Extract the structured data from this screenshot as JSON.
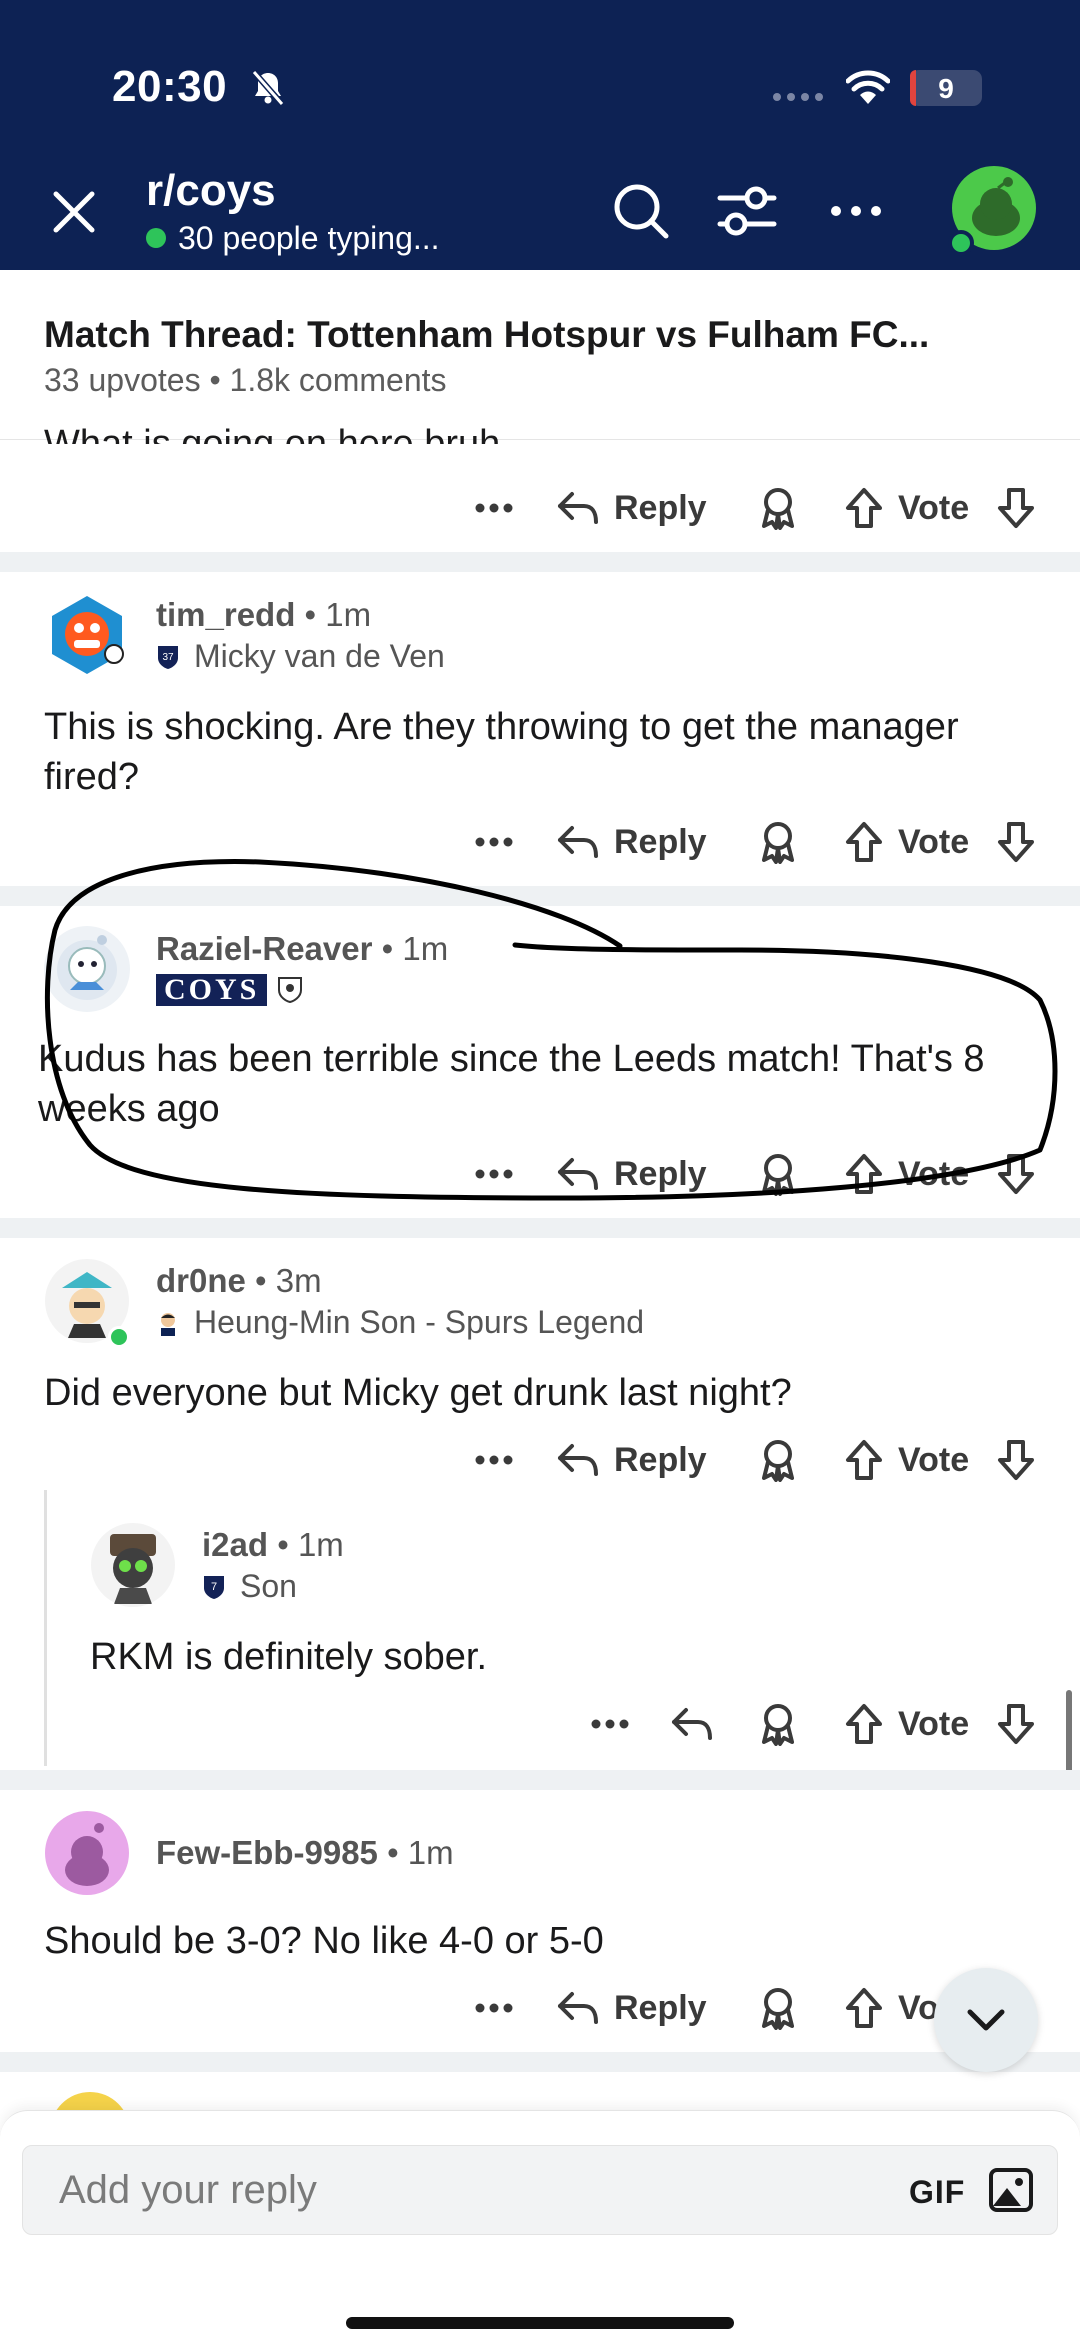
{
  "status_bar": {
    "time": "20:30",
    "battery": "9",
    "battery_level": 0.09
  },
  "header": {
    "subreddit": "r/coys",
    "typing": "30 people typing..."
  },
  "post": {
    "title": "Match Thread: Tottenham Hotspur vs Fulham FC...",
    "upvotes": "33 upvotes",
    "comments": "1.8k comments"
  },
  "partial_comment": {
    "text": "What is going on here bruh"
  },
  "actions": {
    "reply": "Reply",
    "vote": "Vote"
  },
  "comments": [
    {
      "username": "tim_redd",
      "time": "1m",
      "flair": "Micky van de Ven",
      "flair_number": "37",
      "body": "This is shocking. Are they throwing to get the manager fired?"
    },
    {
      "username": "Raziel-Reaver",
      "time": "1m",
      "flair_badge": "COYS",
      "body": "Kudus has been terrible since the Leeds match! That's 8 weeks ago"
    },
    {
      "username": "dr0ne",
      "time": "3m",
      "flair": "Heung-Min Son - Spurs Legend",
      "body": "Did everyone but Micky get drunk last night?"
    },
    {
      "username": "i2ad",
      "time": "1m",
      "flair": "Son",
      "flair_number": "7",
      "body": "RKM is definitely sober."
    },
    {
      "username": "Few-Ebb-9985",
      "time": "1m",
      "body": "Should be 3-0? No like 4-0 or 5-0"
    }
  ],
  "reply_bar": {
    "placeholder": "Add your reply",
    "gif": "GIF"
  },
  "colors": {
    "header_bg": "#0d2254",
    "online": "#2ec45a",
    "battery": "#e0443e"
  }
}
